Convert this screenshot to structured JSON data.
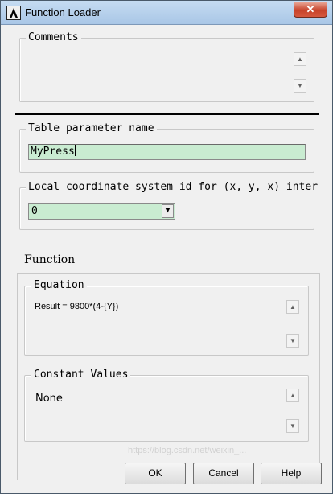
{
  "window": {
    "title": "Function Loader",
    "close_glyph": "✕",
    "app_icon": "ansys-logo-icon"
  },
  "comments": {
    "legend": "Comments",
    "value": ""
  },
  "table_param": {
    "legend": "Table parameter name",
    "value": "MyPress"
  },
  "local_cs": {
    "legend": "Local coordinate system id for (x, y, x) inter",
    "selected": "0"
  },
  "function_tab": {
    "label": "Function"
  },
  "equation": {
    "legend": "Equation",
    "value": "Result = 9800*(4-{Y})"
  },
  "constants": {
    "legend": "Constant Values",
    "value": "None"
  },
  "buttons": {
    "ok": "OK",
    "cancel": "Cancel",
    "help": "Help"
  },
  "watermark": "https://blog.csdn.net/weixin_...",
  "colors": {
    "input_fill": "#c9ecd1",
    "titlebar": "#b6d0ec",
    "close": "#c7432a"
  }
}
